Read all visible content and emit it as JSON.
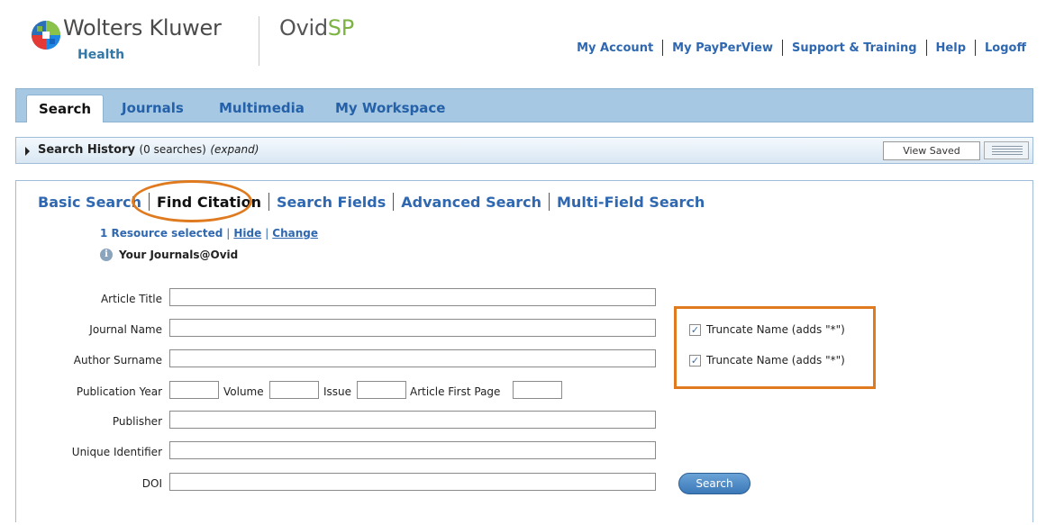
{
  "header": {
    "brand": "Wolters Kluwer",
    "sub_brand": "Health",
    "product_prefix": "Ovid",
    "product_suffix": "SP",
    "links": [
      "My Account",
      "My PayPerView",
      "Support & Training",
      "Help",
      "Logoff"
    ]
  },
  "nav": {
    "tabs": [
      "Search",
      "Journals",
      "Multimedia",
      "My Workspace"
    ],
    "active": "Search"
  },
  "history": {
    "title": "Search History",
    "count": "(0 searches)",
    "expand": "(expand)",
    "view_saved": "View Saved"
  },
  "search_modes": {
    "tabs": [
      "Basic Search",
      "Find Citation",
      "Search Fields",
      "Advanced Search",
      "Multi-Field Search"
    ],
    "active": "Find Citation"
  },
  "resources": {
    "selected": "1 Resource selected",
    "sep": "|",
    "hide": "Hide",
    "change": "Change",
    "journals": "Your Journals@Ovid"
  },
  "form": {
    "article_title": "Article Title",
    "journal_name": "Journal Name",
    "author_surname": "Author Surname",
    "publication_year": "Publication Year",
    "volume": "Volume",
    "issue": "Issue",
    "article_first_page": "Article First Page",
    "publisher": "Publisher",
    "unique_identifier": "Unique Identifier",
    "doi": "DOI",
    "truncate_journal": "Truncate Name (adds \"*\")",
    "truncate_author": "Truncate Name (adds \"*\")",
    "search_button": "Search"
  },
  "colors": {
    "link_blue": "#2f68b0",
    "nav_bar": "#a7c8e2",
    "highlight_orange": "#e07a1f",
    "brand_green": "#7cb342"
  }
}
